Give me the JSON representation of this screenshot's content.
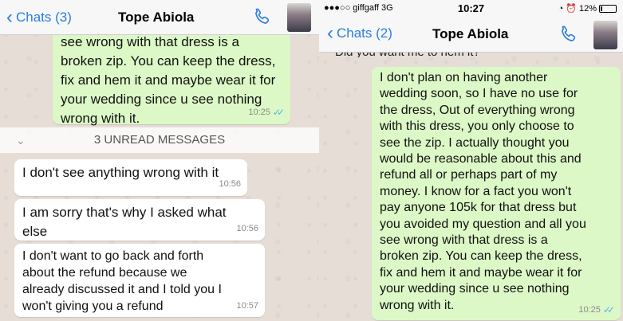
{
  "left": {
    "back_label": "Chats (3)",
    "contact_name": "Tope Abiola",
    "messages_out": [
      {
        "lines": [
          "see wrong with that dress is a",
          "broken zip. You can keep the dress,",
          "fix and hem it and maybe wear it for",
          "your wedding since u see nothing",
          "wrong with it."
        ],
        "time": "10:25"
      }
    ],
    "unread_banner": "3 UNREAD MESSAGES",
    "messages_in": [
      {
        "lines": [
          "I don't see anything wrong with it"
        ],
        "time": "10:56"
      },
      {
        "lines": [
          "I am sorry that's why I asked what",
          "else"
        ],
        "time": "10:56"
      },
      {
        "lines": [
          "I don't want to go back and forth",
          "about the refund because we",
          "already discussed it and I told you I",
          "won't giving you a refund"
        ],
        "time": "10:57"
      }
    ]
  },
  "right": {
    "status": {
      "carrier": "●●●○○ giffgaff  3G",
      "time": "10:27",
      "battery": "12%",
      "battery_level": 0.12
    },
    "back_label": "Chats (2)",
    "contact_name": "Tope Abiola",
    "partial_line": "Did you want me to hem it?",
    "message_out": {
      "lines": [
        "I don't plan on having another",
        "wedding soon, so I have no use for",
        "the dress, Out of everything wrong",
        "with this dress, you only choose to",
        "see the zip. I actually thought you",
        "would be reasonable about this and",
        "refund all or perhaps part of my",
        "money. I know for a fact you won't",
        "pay anyone 105k for that dress but",
        "you avoided my question and all you",
        "see wrong with that dress is a",
        "broken zip. You can keep the dress,",
        "fix and hem it and maybe wear it for",
        "your wedding since u see nothing",
        "wrong with it."
      ],
      "time": "10:25"
    }
  },
  "icons": {
    "back": "chevron-left-icon",
    "call": "phone-icon",
    "read": "double-check-icon",
    "unread_chevron": "chevron-down-icon"
  },
  "colors": {
    "accent": "#2a7de1",
    "outgoing_bubble": "#dcf8c6",
    "incoming_bubble": "#ffffff",
    "read_ticks": "#4fb6ec"
  }
}
